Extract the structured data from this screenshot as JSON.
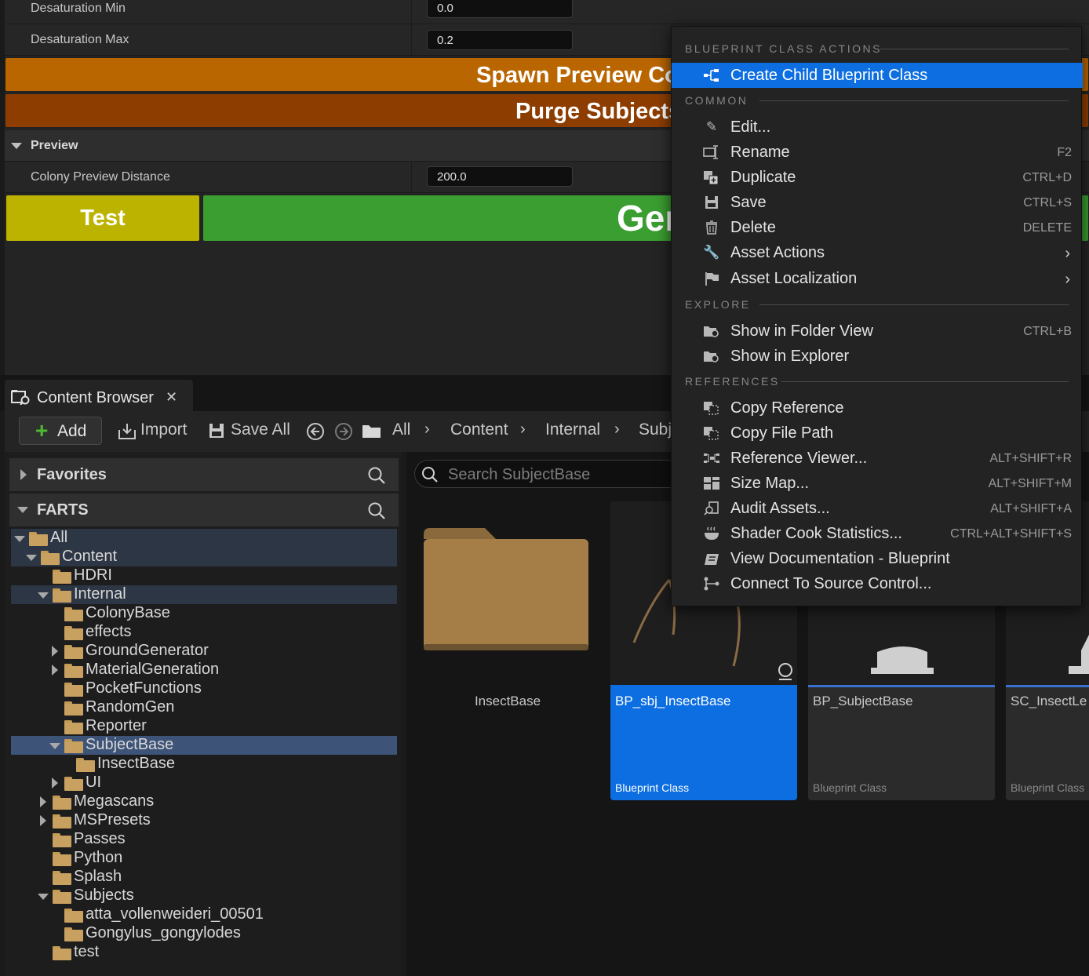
{
  "details": {
    "rows": [
      {
        "label": "Desaturation Min",
        "value": "0.0"
      },
      {
        "label": "Desaturation Max",
        "value": "0.2"
      }
    ],
    "spawn_button": "Spawn Preview Co",
    "purge_button": "Purge Subjects",
    "preview_section": "Preview",
    "colony_preview_distance_label": "Colony Preview Distance",
    "colony_preview_distance_value": "200.0",
    "test_button": "Test",
    "gen_button": "Ger",
    "colors": {
      "spawn": "#b96500",
      "purge": "#8e3d00",
      "test": "#bcb300",
      "gen": "#3b9e31"
    }
  },
  "content_browser": {
    "tab_title": "Content Browser",
    "toolbar": {
      "add": "Add",
      "import": "Import",
      "save_all": "Save All",
      "breadcrumbs": [
        "All",
        "Content",
        "Internal",
        "Subj"
      ]
    },
    "sidebar": {
      "favorites": "Favorites",
      "project": "FARTS",
      "tree": [
        {
          "label": "All",
          "depth": 0,
          "expander": "down",
          "state": "hl"
        },
        {
          "label": "Content",
          "depth": 1,
          "expander": "down",
          "state": "hl"
        },
        {
          "label": "HDRI",
          "depth": 2,
          "expander": "none",
          "state": ""
        },
        {
          "label": "Internal",
          "depth": 2,
          "expander": "down",
          "state": "hl"
        },
        {
          "label": "ColonyBase",
          "depth": 3,
          "expander": "none",
          "state": ""
        },
        {
          "label": "effects",
          "depth": 3,
          "expander": "none",
          "state": ""
        },
        {
          "label": "GroundGenerator",
          "depth": 3,
          "expander": "right",
          "state": ""
        },
        {
          "label": "MaterialGeneration",
          "depth": 3,
          "expander": "right",
          "state": ""
        },
        {
          "label": "PocketFunctions",
          "depth": 3,
          "expander": "none",
          "state": ""
        },
        {
          "label": "RandomGen",
          "depth": 3,
          "expander": "none",
          "state": ""
        },
        {
          "label": "Reporter",
          "depth": 3,
          "expander": "none",
          "state": ""
        },
        {
          "label": "SubjectBase",
          "depth": 3,
          "expander": "down",
          "state": "sel"
        },
        {
          "label": "InsectBase",
          "depth": 4,
          "expander": "none",
          "state": ""
        },
        {
          "label": "UI",
          "depth": 3,
          "expander": "right",
          "state": ""
        },
        {
          "label": "Megascans",
          "depth": 2,
          "expander": "right",
          "state": ""
        },
        {
          "label": "MSPresets",
          "depth": 2,
          "expander": "right",
          "state": ""
        },
        {
          "label": "Passes",
          "depth": 2,
          "expander": "none",
          "state": ""
        },
        {
          "label": "Python",
          "depth": 2,
          "expander": "none",
          "state": ""
        },
        {
          "label": "Splash",
          "depth": 2,
          "expander": "none",
          "state": ""
        },
        {
          "label": "Subjects",
          "depth": 2,
          "expander": "down",
          "state": ""
        },
        {
          "label": "atta_vollenweideri_00501",
          "depth": 3,
          "expander": "none",
          "state": ""
        },
        {
          "label": "Gongylus_gongylodes",
          "depth": 3,
          "expander": "none",
          "state": ""
        },
        {
          "label": "test",
          "depth": 2,
          "expander": "none",
          "state": ""
        }
      ]
    },
    "search_placeholder": "Search SubjectBase",
    "assets": [
      {
        "name": "InsectBase",
        "class": ""
      },
      {
        "name": "BP_sbj_InsectBase",
        "class": "Blueprint Class"
      },
      {
        "name": "BP_SubjectBase",
        "class": "Blueprint Class"
      },
      {
        "name": "SC_InsectLe",
        "class": "Blueprint Class"
      }
    ]
  },
  "context_menu": {
    "sections": {
      "blueprint": "BLUEPRINT CLASS ACTIONS",
      "common": "COMMON",
      "explore": "EXPLORE",
      "references": "REFERENCES"
    },
    "items": {
      "create_child": {
        "label": "Create Child Blueprint Class",
        "shortcut": ""
      },
      "edit": {
        "label": "Edit...",
        "shortcut": ""
      },
      "rename": {
        "label": "Rename",
        "shortcut": "F2"
      },
      "duplicate": {
        "label": "Duplicate",
        "shortcut": "CTRL+D"
      },
      "save": {
        "label": "Save",
        "shortcut": "CTRL+S"
      },
      "delete": {
        "label": "Delete",
        "shortcut": "DELETE"
      },
      "asset_actions": {
        "label": "Asset Actions",
        "shortcut": ""
      },
      "asset_localization": {
        "label": "Asset Localization",
        "shortcut": ""
      },
      "show_folder": {
        "label": "Show in Folder View",
        "shortcut": "CTRL+B"
      },
      "show_explorer": {
        "label": "Show in Explorer",
        "shortcut": ""
      },
      "copy_reference": {
        "label": "Copy Reference",
        "shortcut": ""
      },
      "copy_file_path": {
        "label": "Copy File Path",
        "shortcut": ""
      },
      "reference_viewer": {
        "label": "Reference Viewer...",
        "shortcut": "ALT+SHIFT+R"
      },
      "size_map": {
        "label": "Size Map...",
        "shortcut": "ALT+SHIFT+M"
      },
      "audit_assets": {
        "label": "Audit Assets...",
        "shortcut": "ALT+SHIFT+A"
      },
      "shader_cook": {
        "label": "Shader Cook Statistics...",
        "shortcut": "CTRL+ALT+SHIFT+S"
      },
      "view_docs": {
        "label": "View Documentation - Blueprint",
        "shortcut": ""
      },
      "source_control": {
        "label": "Connect To Source Control...",
        "shortcut": ""
      }
    },
    "highlight_color": "#0c6ee0"
  }
}
